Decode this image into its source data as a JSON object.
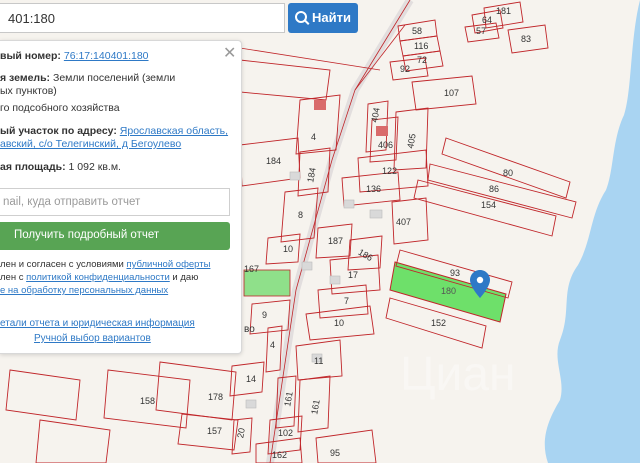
{
  "search": {
    "value": "401:180",
    "button_label": "Найти"
  },
  "info": {
    "cadastral_label": "вый номер:",
    "cadastral_value": "76:17:140401:180",
    "category_label": "я земель:",
    "category_value_1": "Земли поселений (земли",
    "category_value_2": "ых пунктов)",
    "usage_value": "го подсобного хозяйства",
    "address_label": "ый участок по адресу:",
    "address_value_1": "Ярославская область,",
    "address_value_2": "авский, с/о Телегинский, д Бегоулево",
    "area_label": "ая площадь:",
    "area_value": "1 092 кв.м."
  },
  "email": {
    "placeholder": "nail, куда отправить отчет"
  },
  "report_button": "Получить подробный отчет",
  "consent": {
    "line1_text": "лен и согласен с условиями ",
    "line1_link": "публичной оферты",
    "line2_text": "лен с ",
    "line2_link": "политикой конфиденциальности",
    "line2_text_2": " и даю",
    "line3_link": "е на обработку персональных данных"
  },
  "links": {
    "details": "етали отчета и юридическая информация",
    "manual": "Ручной выбор вариантов"
  },
  "parcels": [
    {
      "label": "181"
    },
    {
      "label": "64"
    },
    {
      "label": "57"
    },
    {
      "label": "83"
    },
    {
      "label": "58"
    },
    {
      "label": "116"
    },
    {
      "label": "72"
    },
    {
      "label": "92"
    },
    {
      "label": "107"
    },
    {
      "label": "4"
    },
    {
      "label": "184"
    },
    {
      "label": "184"
    },
    {
      "label": "404"
    },
    {
      "label": "406"
    },
    {
      "label": "405"
    },
    {
      "label": "122"
    },
    {
      "label": "80"
    },
    {
      "label": "86"
    },
    {
      "label": "154"
    },
    {
      "label": "136"
    },
    {
      "label": "407"
    },
    {
      "label": "8"
    },
    {
      "label": "187"
    },
    {
      "label": "186"
    },
    {
      "label": "10"
    },
    {
      "label": "167"
    },
    {
      "label": "17"
    },
    {
      "label": "7"
    },
    {
      "label": "10"
    },
    {
      "label": "93"
    },
    {
      "label": "180"
    },
    {
      "label": "152"
    },
    {
      "label": "9"
    },
    {
      "label": "4"
    },
    {
      "label": "14"
    },
    {
      "label": "11"
    },
    {
      "label": "158"
    },
    {
      "label": "178"
    },
    {
      "label": "161"
    },
    {
      "label": "161"
    },
    {
      "label": "157"
    },
    {
      "label": "20"
    },
    {
      "label": "102"
    },
    {
      "label": "162"
    },
    {
      "label": "95"
    }
  ],
  "village_label": "во",
  "watermark": "Циан",
  "colors": {
    "water": "#a9d4f2",
    "selected_parcel": "#6ee06a",
    "parcel_outline": "#c0262a",
    "road": "#d8d8d8",
    "marker": "#2e79c6"
  }
}
